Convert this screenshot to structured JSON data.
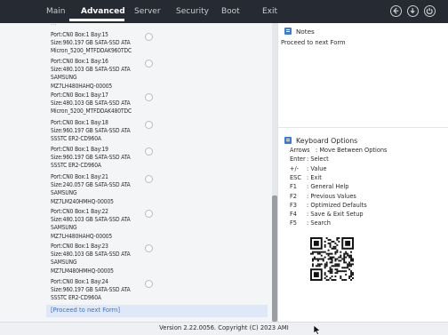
{
  "topbar": {
    "tabs": [
      {
        "label": "Main",
        "active": false
      },
      {
        "label": "Advanced",
        "active": true
      },
      {
        "label": "Server",
        "active": false
      },
      {
        "label": "Security",
        "active": false
      },
      {
        "label": "Boot",
        "active": false
      },
      {
        "label": "Exit",
        "active": false
      }
    ],
    "icons": [
      "back-icon",
      "download-icon",
      "power-icon"
    ]
  },
  "drive_list": {
    "partial_top": "...",
    "entries": [
      {
        "lines": [
          "Port:CN0 Box:1 Bay:15",
          "Size:960.197 GB SATA-SSD ATA",
          "Micron_5200_MTFDDAK960TDC"
        ]
      },
      {
        "lines": [
          "Port:CN0 Box:1 Bay:16",
          "Size:480.103 GB SATA-SSD ATA",
          "SAMSUNG",
          "MZ7LH480HAHQ-00005"
        ]
      },
      {
        "lines": [
          "Port:CN0 Box:1 Bay:17",
          "Size:480.103 GB SATA-SSD ATA",
          "Micron_5200_MTFDDAK480TDC"
        ]
      },
      {
        "lines": [
          "Port:CN0 Box:1 Bay:18",
          "Size:960.197 GB SATA-SSD ATA",
          "SSSTC ER2-CD960A"
        ]
      },
      {
        "lines": [
          "Port:CN0 Box:1 Bay:19",
          "Size:960.197 GB SATA-SSD ATA",
          "SSSTC ER2-CD960A"
        ]
      },
      {
        "lines": [
          "Port:CN0 Box:1 Bay:21",
          "Size:240.057 GB SATA-SSD ATA",
          "SAMSUNG",
          "MZ7LM240HMHQ-00005"
        ]
      },
      {
        "lines": [
          "Port:CN0 Box:1 Bay:22",
          "Size:480.103 GB SATA-SSD ATA",
          "SAMSUNG",
          "MZ7LH480HAHQ-00005"
        ]
      },
      {
        "lines": [
          "Port:CN0 Box:1 Bay:23",
          "Size:480.103 GB SATA-SSD ATA",
          "SAMSUNG",
          "MZ7LM480HMHQ-00005"
        ]
      },
      {
        "lines": [
          "Port:CN0 Box:1 Bay:24",
          "Size:960.197 GB SATA-SSD ATA",
          "SSSTC ER2-CD960A"
        ]
      }
    ],
    "proceed_link": "[Proceed to next Form]"
  },
  "notes": {
    "title": "Notes",
    "text": "Proceed to next Form"
  },
  "keyboard_options": {
    "title": "Keyboard Options",
    "rows": [
      {
        "key": "Arrows",
        "desc": ": Move Between Options",
        "inline": true
      },
      {
        "key": "Enter",
        "desc": ": Select"
      },
      {
        "key": "+/-",
        "desc": ": Value"
      },
      {
        "key": "ESC",
        "desc": ": Exit"
      },
      {
        "key": "F1",
        "desc": ": General Help"
      },
      {
        "key": "F2",
        "desc": ": Previous Values"
      },
      {
        "key": "F3",
        "desc": ": Optimized Defaults"
      },
      {
        "key": "F4",
        "desc": ": Save & Exit Setup"
      },
      {
        "key": "F5",
        "desc": ": Search"
      }
    ],
    "qr_code": "qr-code-icon"
  },
  "footer": {
    "version": "Version 2.22.0056. Copyright (C) 2023 AMI"
  },
  "colors": {
    "topbar": "#262b33",
    "accent": "#3a7bd5",
    "link": "#3b6fc2",
    "highlight": "#dfe8f7"
  }
}
